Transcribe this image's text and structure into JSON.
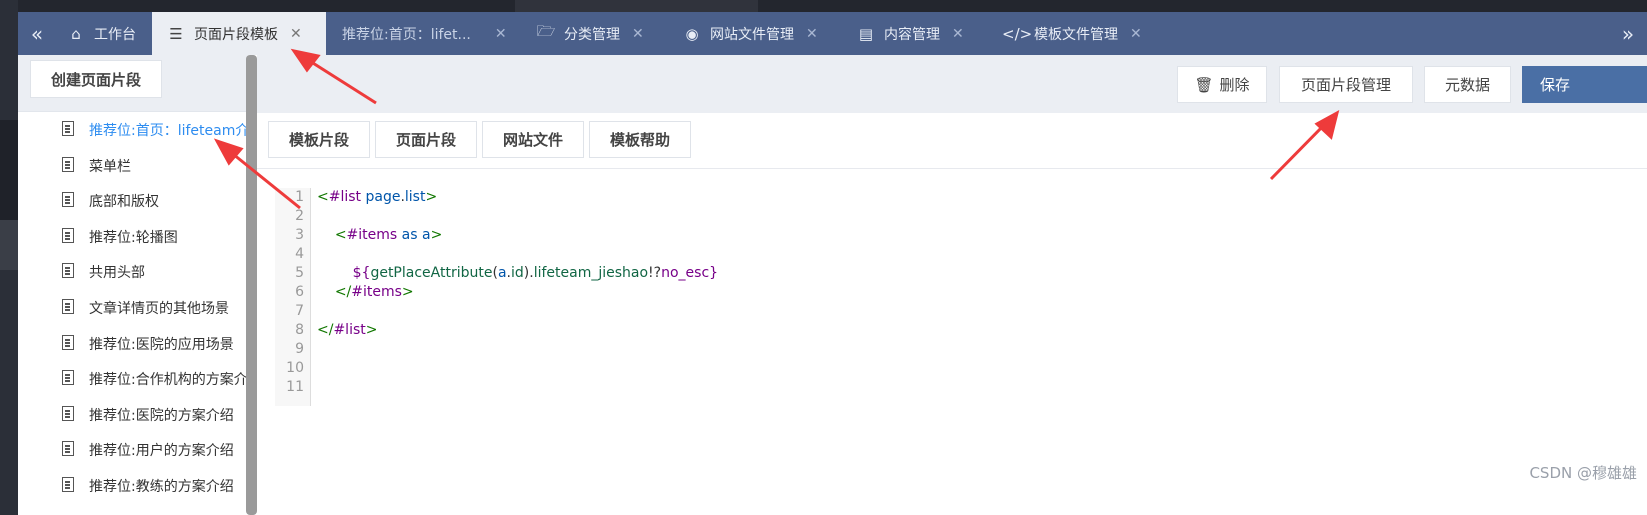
{
  "tabs": {
    "collapse_icon": "double-chevron-left-icon",
    "expand_icon": "double-chevron-right-icon",
    "items": [
      {
        "label": "工作台",
        "icon": "home-icon"
      },
      {
        "label": "页面片段模板",
        "icon": "list-icon",
        "active": true
      },
      {
        "label": "推荐位:首页：lifet...",
        "icon": ""
      },
      {
        "label": "分类管理",
        "icon": "folder-open-icon"
      },
      {
        "label": "网站文件管理",
        "icon": "globe-icon"
      },
      {
        "label": "内容管理",
        "icon": "book-icon"
      },
      {
        "label": "模板文件管理",
        "icon": "code-icon"
      }
    ]
  },
  "sidebar": {
    "create_button": "创建页面片段",
    "items": [
      {
        "label": "推荐位:首页：lifeteam介",
        "selected": true
      },
      {
        "label": "菜单栏"
      },
      {
        "label": "底部和版权"
      },
      {
        "label": "推荐位:轮播图"
      },
      {
        "label": "共用头部"
      },
      {
        "label": "文章详情页的其他场景"
      },
      {
        "label": "推荐位:医院的应用场景"
      },
      {
        "label": "推荐位:合作机构的方案介"
      },
      {
        "label": "推荐位:医院的方案介绍"
      },
      {
        "label": "推荐位:用户的方案介绍"
      },
      {
        "label": "推荐位:教练的方案介绍"
      }
    ]
  },
  "toolbar": {
    "delete": "删除",
    "fragment_manage": "页面片段管理",
    "metadata": "元数据",
    "save": "保存"
  },
  "fragment_tabs": [
    "模板片段",
    "页面片段",
    "网站文件",
    "模板帮助"
  ],
  "editor": {
    "line_numbers": [
      "1",
      "2",
      "3",
      "4",
      "5",
      "6",
      "7",
      "8",
      "9",
      "10",
      "11"
    ]
  },
  "watermark": "CSDN @穆雄雄",
  "colors": {
    "tabbar": "#4a5f8a",
    "selected_link": "#2d8cf0",
    "annotation_arrow": "#ee3b3b"
  }
}
